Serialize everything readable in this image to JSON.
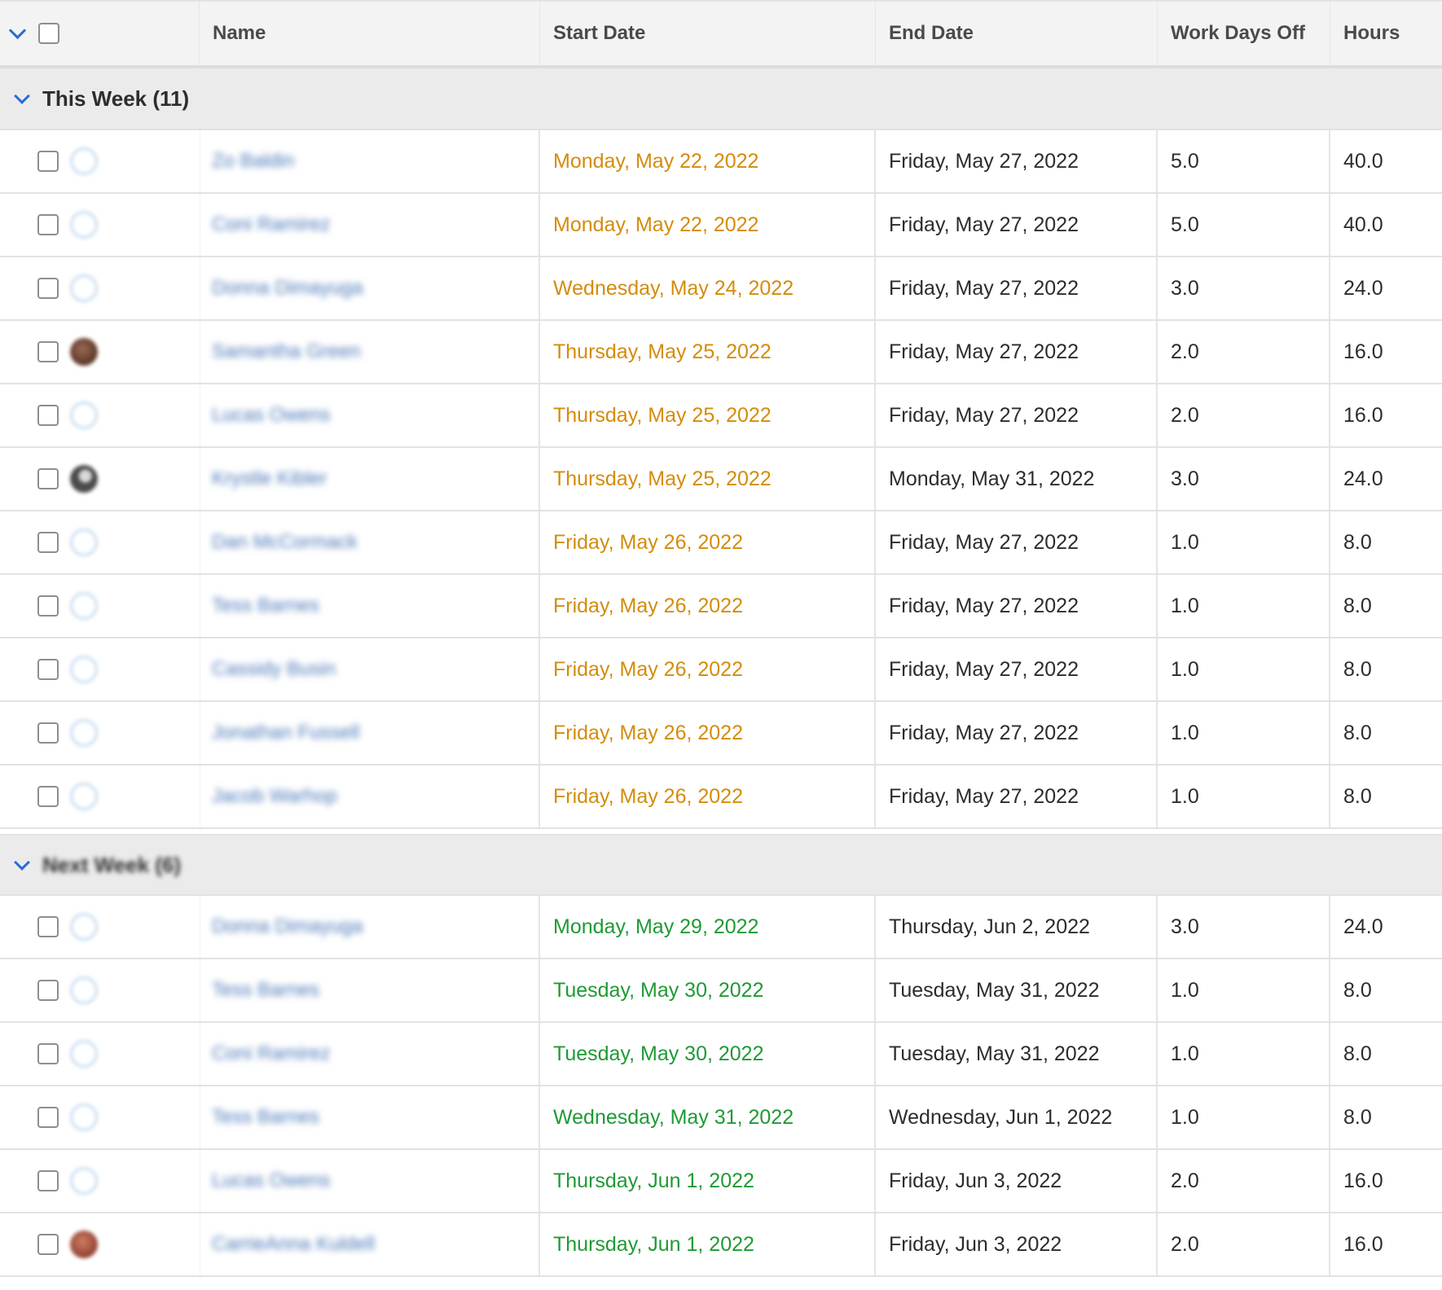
{
  "header": {
    "columns": {
      "name": "Name",
      "start_date": "Start Date",
      "end_date": "End Date",
      "work_days_off": "Work Days Off",
      "hours": "Hours"
    }
  },
  "groups": [
    {
      "label": "This Week (11)",
      "rows": [
        {
          "name": "Zo Baldin",
          "start": "Monday, May 22, 2022",
          "end": "Friday, May 27, 2022",
          "days": "5.0",
          "hours": "40.0",
          "avatar": "placeholder"
        },
        {
          "name": "Coni Ramirez",
          "start": "Monday, May 22, 2022",
          "end": "Friday, May 27, 2022",
          "days": "5.0",
          "hours": "40.0",
          "avatar": "placeholder"
        },
        {
          "name": "Donna Dimayuga",
          "start": "Wednesday, May 24, 2022",
          "end": "Friday, May 27, 2022",
          "days": "3.0",
          "hours": "24.0",
          "avatar": "placeholder"
        },
        {
          "name": "Samantha Green",
          "start": "Thursday, May 25, 2022",
          "end": "Friday, May 27, 2022",
          "days": "2.0",
          "hours": "16.0",
          "avatar": "photo-a"
        },
        {
          "name": "Lucas Owens",
          "start": "Thursday, May 25, 2022",
          "end": "Friday, May 27, 2022",
          "days": "2.0",
          "hours": "16.0",
          "avatar": "placeholder"
        },
        {
          "name": "Krystle Kibler",
          "start": "Thursday, May 25, 2022",
          "end": "Monday, May 31, 2022",
          "days": "3.0",
          "hours": "24.0",
          "avatar": "photo-b"
        },
        {
          "name": "Dan McCormack",
          "start": "Friday, May 26, 2022",
          "end": "Friday, May 27, 2022",
          "days": "1.0",
          "hours": "8.0",
          "avatar": "placeholder"
        },
        {
          "name": "Tess Barnes",
          "start": "Friday, May 26, 2022",
          "end": "Friday, May 27, 2022",
          "days": "1.0",
          "hours": "8.0",
          "avatar": "placeholder"
        },
        {
          "name": "Cassidy Busin",
          "start": "Friday, May 26, 2022",
          "end": "Friday, May 27, 2022",
          "days": "1.0",
          "hours": "8.0",
          "avatar": "placeholder"
        },
        {
          "name": "Jonathan Fussell",
          "start": "Friday, May 26, 2022",
          "end": "Friday, May 27, 2022",
          "days": "1.0",
          "hours": "8.0",
          "avatar": "placeholder"
        },
        {
          "name": "Jacob Warhop",
          "start": "Friday, May 26, 2022",
          "end": "Friday, May 27, 2022",
          "days": "1.0",
          "hours": "8.0",
          "avatar": "placeholder"
        }
      ],
      "start_color": "#d48c0a"
    },
    {
      "label": "Next Week (6)",
      "rows": [
        {
          "name": "Donna Dimayuga",
          "start": "Monday, May 29, 2022",
          "end": "Thursday, Jun 2, 2022",
          "days": "3.0",
          "hours": "24.0",
          "avatar": "placeholder"
        },
        {
          "name": "Tess Barnes",
          "start": "Tuesday, May 30, 2022",
          "end": "Tuesday, May 31, 2022",
          "days": "1.0",
          "hours": "8.0",
          "avatar": "placeholder"
        },
        {
          "name": "Coni Ramirez",
          "start": "Tuesday, May 30, 2022",
          "end": "Tuesday, May 31, 2022",
          "days": "1.0",
          "hours": "8.0",
          "avatar": "placeholder"
        },
        {
          "name": "Tess Barnes",
          "start": "Wednesday, May 31, 2022",
          "end": "Wednesday, Jun 1, 2022",
          "days": "1.0",
          "hours": "8.0",
          "avatar": "placeholder"
        },
        {
          "name": "Lucas Owens",
          "start": "Thursday, Jun 1, 2022",
          "end": "Friday, Jun 3, 2022",
          "days": "2.0",
          "hours": "16.0",
          "avatar": "placeholder"
        },
        {
          "name": "CarrieAnna Kuldell",
          "start": "Thursday, Jun 1, 2022",
          "end": "Friday, Jun 3, 2022",
          "days": "2.0",
          "hours": "16.0",
          "avatar": "photo-c"
        }
      ],
      "start_color": "#1f9a34"
    }
  ],
  "colors": {
    "accent": "#2a6bd3",
    "name_link": "#4a78b8",
    "this_week_start": "#d48c0a",
    "next_week_start": "#1f9a34"
  },
  "icons": {
    "collapse": "chevron-down-icon",
    "avatar_placeholder": "user-placeholder-icon"
  }
}
